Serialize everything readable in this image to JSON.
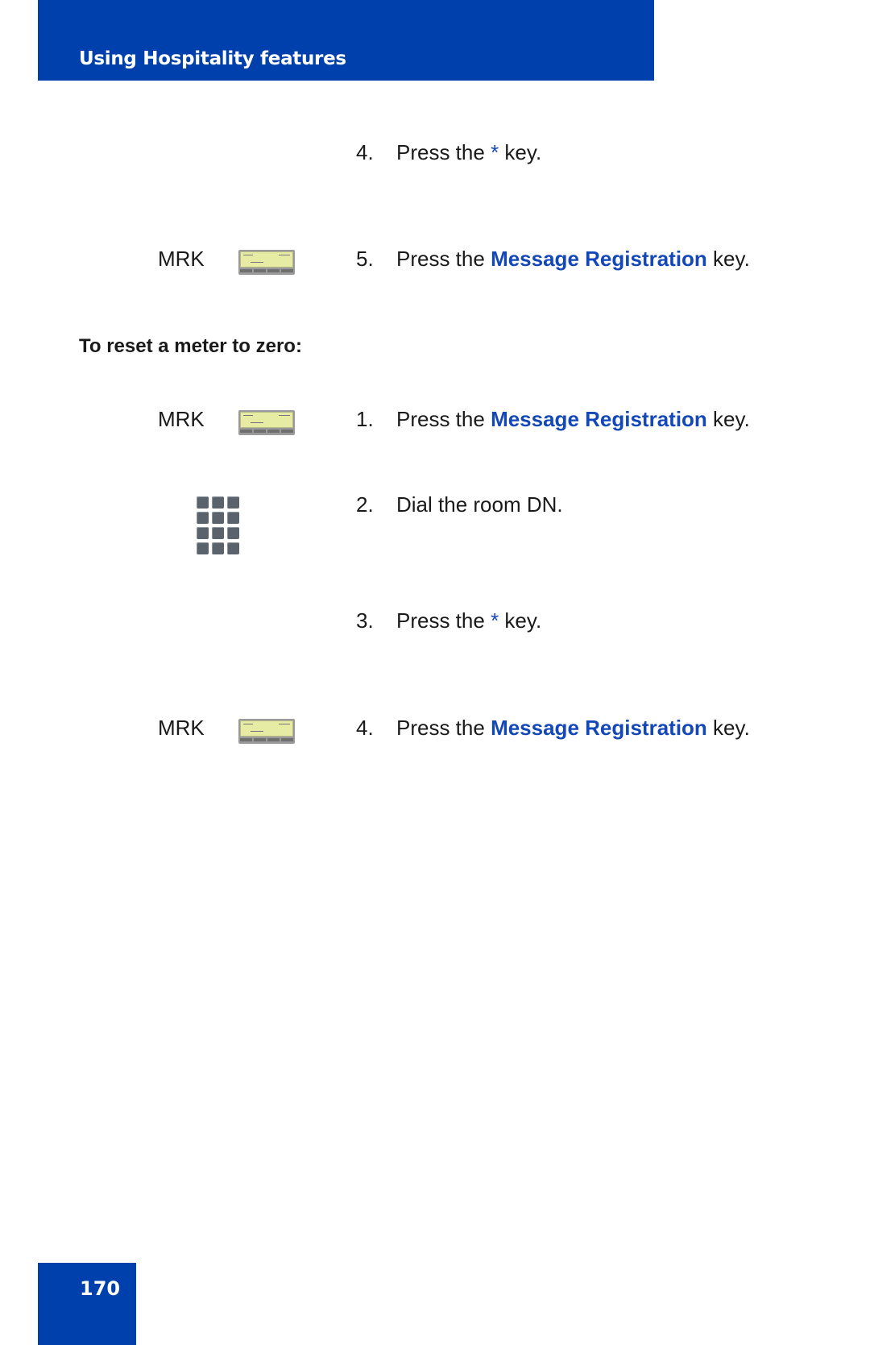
{
  "header": {
    "title": "Using Hospitality features"
  },
  "steps_part1": [
    {
      "num": "4.",
      "pre": "Press the ",
      "key": "*",
      "key_style": "star",
      "post": " key."
    },
    {
      "num": "5.",
      "pre": "Press the ",
      "key": "Message Registration",
      "key_style": "bold",
      "post": " key.",
      "side_label": "MRK",
      "icon": "display-icon"
    }
  ],
  "section": {
    "heading": "To reset a meter to zero:"
  },
  "steps_part2": [
    {
      "num": "1.",
      "pre": "Press the ",
      "key": "Message Registration",
      "post": " key.",
      "side_label": "MRK",
      "icon": "display-icon"
    },
    {
      "num": "2.",
      "text": "Dial the room DN.",
      "icon": "keypad-icon"
    },
    {
      "num": "3.",
      "pre": "Press the ",
      "key": "*",
      "post": " key."
    },
    {
      "num": "4.",
      "pre": "Press the ",
      "key": "Message Registration",
      "post": " key.",
      "side_label": "MRK",
      "icon": "display-icon"
    }
  ],
  "footer": {
    "page_number": "170"
  },
  "colors": {
    "brand_blue": "#0040ac",
    "highlight_blue": "#1448b8"
  }
}
